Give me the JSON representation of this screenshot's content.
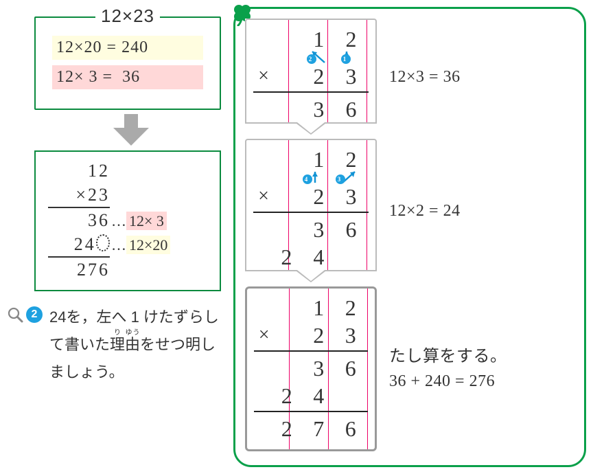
{
  "left_box": {
    "title": "12×23",
    "line1": "12×20 = 240",
    "line2": "12× 3 =  36"
  },
  "calc": {
    "r1": " 12",
    "r2": "×23",
    "r3": " 36",
    "r3_ann": "12× 3",
    "r4_prefix": "24",
    "r4_ann": "12×20",
    "r5": "276"
  },
  "question": {
    "num": "2",
    "text": "24を，左へ 1 けたずらして書いた理由をせつ明しましょう。",
    "ruby_ri": "り",
    "ruby_yuu": "ゆう"
  },
  "steps": {
    "s1_label": "12×3 = 36",
    "s2_label": "12×2 = 24",
    "s3_label_a": "たし算をする。",
    "s3_label_b": "36 + 240 = 276"
  },
  "card": {
    "top1": "1",
    "top2": "2",
    "m1": "2",
    "m2": "3",
    "op": "×",
    "p1_1": "3",
    "p1_2": "6",
    "p2_0": "2",
    "p2_1": "4",
    "ans0": "2",
    "ans1": "7",
    "ans2": "6",
    "badge1": "1",
    "badge2": "2",
    "badge3": "3",
    "badge4": "4"
  },
  "chart_data": {
    "type": "table",
    "title": "Long multiplication 12 × 23",
    "operands": [
      12,
      23
    ],
    "partial_products": [
      {
        "factor": 3,
        "expression": "12×3",
        "value": 36,
        "shift": 0
      },
      {
        "factor": 20,
        "expression": "12×20",
        "value": 240,
        "shift": 1
      }
    ],
    "sum_expression": "36 + 240",
    "result": 276
  }
}
